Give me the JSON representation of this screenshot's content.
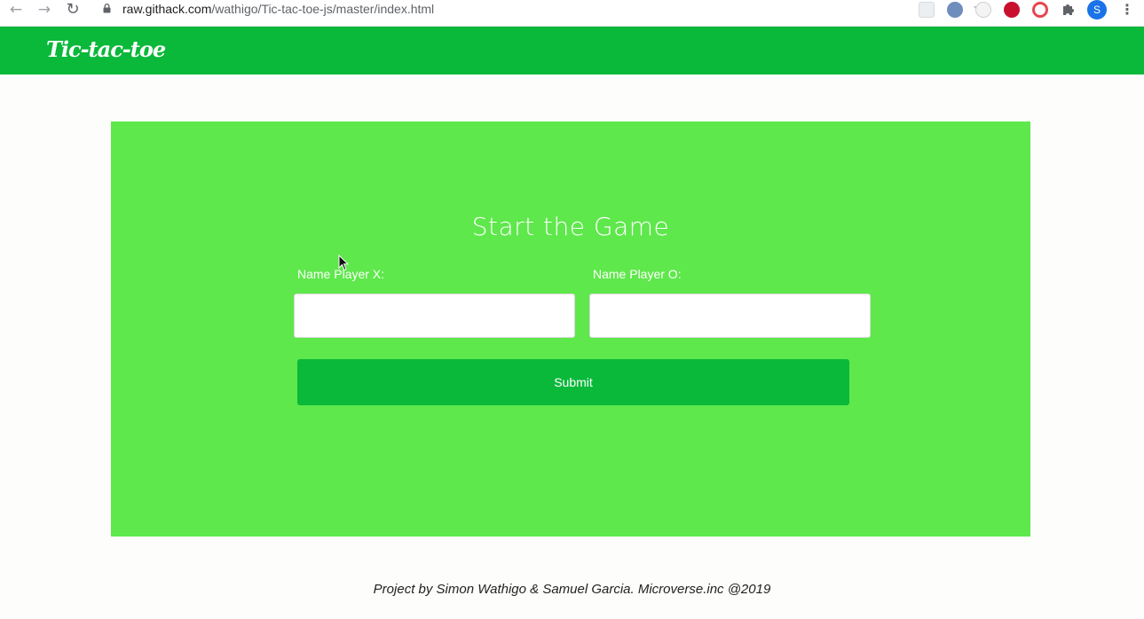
{
  "browser": {
    "url_host": "raw.githack.com",
    "url_path": "/wathigo/Tic-tac-toe-js/master/index.html",
    "profile_initial": "S",
    "icons": {
      "back": "arrow-left-icon",
      "forward": "arrow-right-icon",
      "reload": "reload-icon",
      "lock": "lock-icon",
      "bookmark": "star-icon",
      "extensions": "puzzle-icon",
      "menu": "kebab-menu-icon"
    }
  },
  "navbar": {
    "brand": "Tic-tac-toe",
    "color": "#0ab83a"
  },
  "game": {
    "title": "Start the Game",
    "player_x_label": "Name Player X:",
    "player_o_label": "Name Player O:",
    "player_x_value": "",
    "player_o_value": "",
    "submit_label": "Submit",
    "card_color": "#5ee84b"
  },
  "footer": {
    "text": "Project by Simon Wathigo & Samuel Garcia. Microverse.inc @2019"
  }
}
